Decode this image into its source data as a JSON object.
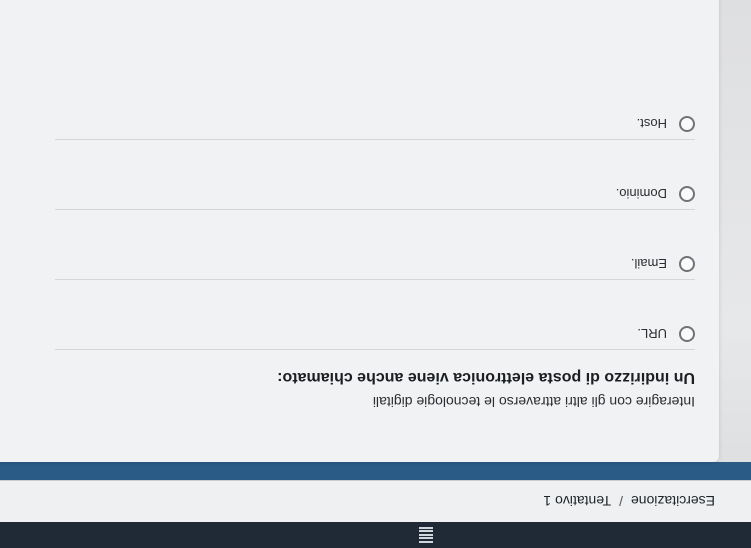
{
  "breadcrumb": {
    "items": [
      "Esercitazione",
      "Tentativo 1"
    ],
    "separator": "/"
  },
  "quiz": {
    "instruction": "Interagire con gli altri attraverso le tecnologie digitali",
    "question": "Un indirizzo di posta elettronica viene anche chiamato:",
    "options": [
      "URL.",
      "Email.",
      "Dominio.",
      "Host."
    ]
  },
  "icons": {
    "menu": "hamburger-menu-icon",
    "radio": "radio-unchecked-icon"
  },
  "colors": {
    "topbar": "#1f2a36",
    "accent_strip": "#2a5a86",
    "card_bg": "#f1f2f3"
  }
}
